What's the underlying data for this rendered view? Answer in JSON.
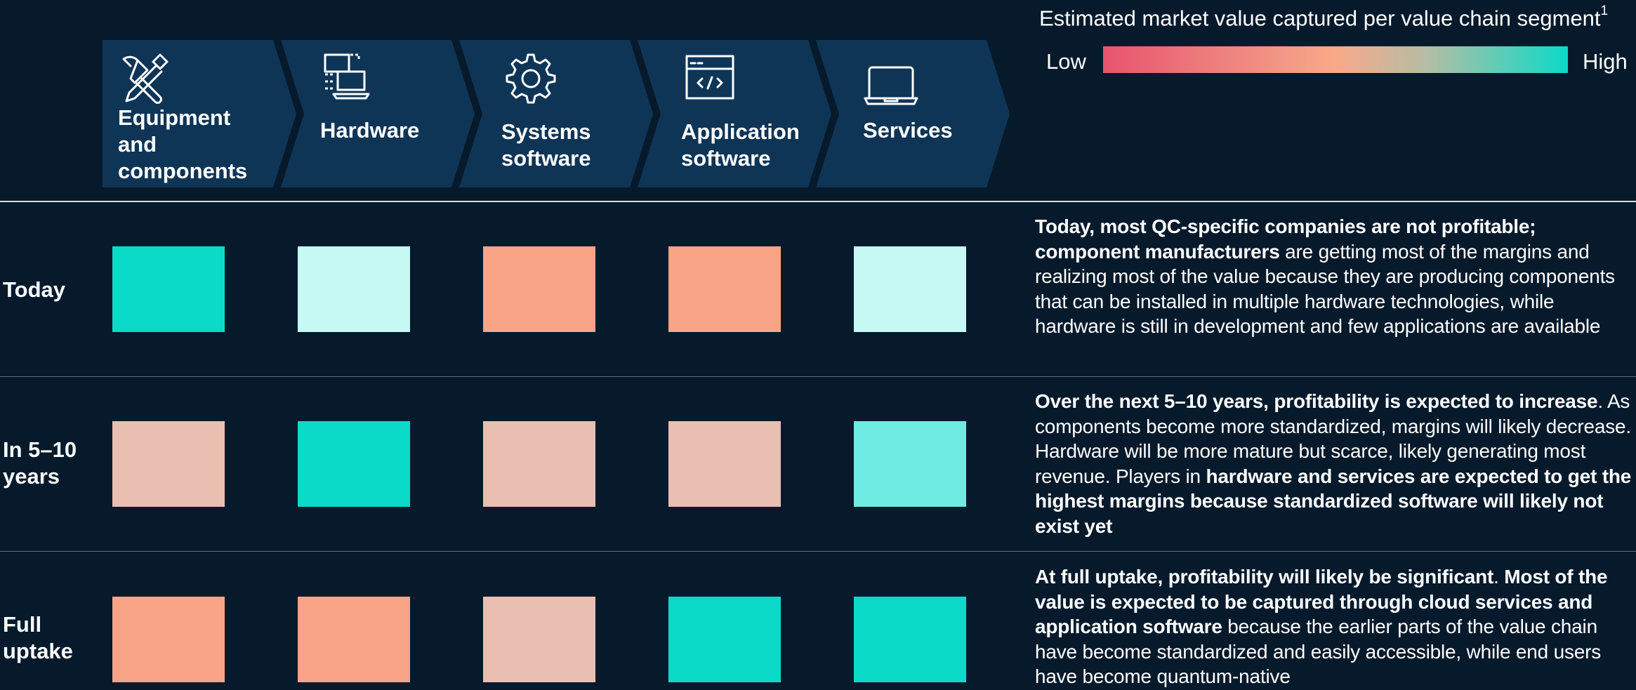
{
  "value_chain": {
    "segments": [
      {
        "label": "Equipment\nand\ncomponents",
        "icon": "tools-icon"
      },
      {
        "label": "Hardware",
        "icon": "computers-icon"
      },
      {
        "label": "Systems\nsoftware",
        "icon": "gear-icon"
      },
      {
        "label": "Application\nsoftware",
        "icon": "code-window-icon"
      },
      {
        "label": "Services",
        "icon": "laptop-icon"
      }
    ],
    "chevron_color": "#0f3556"
  },
  "legend": {
    "title": "Estimated market value captured per value chain segment",
    "footnote": "1",
    "low_label": "Low",
    "high_label": "High",
    "low_color": "#e8546e",
    "high_color": "#0cdac9"
  },
  "rows": [
    {
      "label": "Today",
      "cells": [
        "#0cdac9",
        "#c6f8f4",
        "#f9a387",
        "#f9a387",
        "#c6f8f4"
      ],
      "description": [
        {
          "text": "Today, most QC-specific companies are not profitable; component manufacturers",
          "bold": true
        },
        {
          "text": " are getting most of the margins and realizing most of the value because they are producing components that can be installed in multiple hardware technologies, while hardware is still in development and few applications are available",
          "bold": false
        }
      ]
    },
    {
      "label": "In 5–10\nyears",
      "cells": [
        "#e8bfb0",
        "#0cdac9",
        "#e8bfb0",
        "#e8bfb0",
        "#6eece3"
      ],
      "description": [
        {
          "text": "Over the next 5–10 years, profitability is expected to increase",
          "bold": true
        },
        {
          "text": ". As components become more standardized, margins will likely decrease. Hardware will be more mature but scarce, likely generating most revenue. Players in ",
          "bold": false
        },
        {
          "text": "hardware and services are expected to get the highest margins because standardized software will likely not exist yet",
          "bold": true
        }
      ]
    },
    {
      "label": "Full\nuptake",
      "cells": [
        "#f9a387",
        "#f9a387",
        "#e8bfb0",
        "#0cdac9",
        "#0cdac9"
      ],
      "description": [
        {
          "text": "At full uptake, profitability will likely be significant",
          "bold": true
        },
        {
          "text": ". ",
          "bold": false
        },
        {
          "text": "Most of the value is expected to be captured through cloud services and application software",
          "bold": true
        },
        {
          "text": " because the earlier parts of the value chain have become standardized and easily accessible, while end users have become quantum-native",
          "bold": false
        }
      ]
    }
  ]
}
